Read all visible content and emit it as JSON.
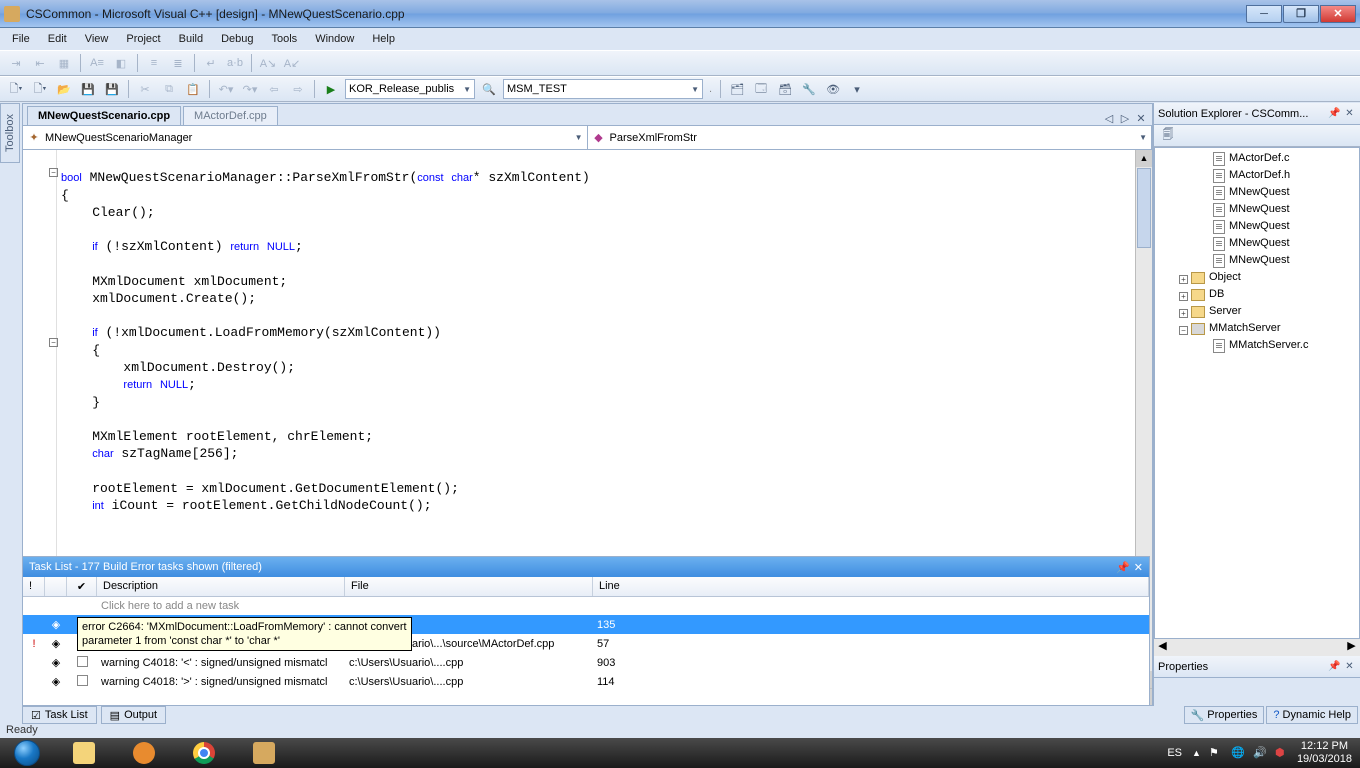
{
  "window": {
    "title": "CSCommon - Microsoft Visual C++ [design] - MNewQuestScenario.cpp"
  },
  "menu": [
    "File",
    "Edit",
    "View",
    "Project",
    "Build",
    "Debug",
    "Tools",
    "Window",
    "Help"
  ],
  "toolbar2": {
    "config": "KOR_Release_publis",
    "target": "MSM_TEST"
  },
  "tabs": {
    "active": "MNewQuestScenario.cpp",
    "inactive": "MActorDef.cpp"
  },
  "nav": {
    "cls": "MNewQuestScenarioManager",
    "member": "ParseXmlFromStr"
  },
  "code_lines": [
    "",
    "bool MNewQuestScenarioManager::ParseXmlFromStr(const char* szXmlContent)",
    "{",
    "    Clear();",
    "",
    "    if (!szXmlContent) return NULL;",
    "",
    "    MXmlDocument xmlDocument;",
    "    xmlDocument.Create();",
    "",
    "    if (!xmlDocument.LoadFromMemory(szXmlContent))",
    "    {",
    "        xmlDocument.Destroy();",
    "        return NULL;",
    "    }",
    "",
    "    MXmlElement rootElement, chrElement;",
    "    char szTagName[256];",
    "",
    "    rootElement = xmlDocument.GetDocumentElement();",
    "    int iCount = rootElement.GetChildNodeCount();"
  ],
  "solution": {
    "title": "Solution Explorer - CSComm...",
    "files": [
      "MActorDef.c",
      "MActorDef.h",
      "MNewQuest",
      "MNewQuest",
      "MNewQuest",
      "MNewQuest",
      "MNewQuest"
    ],
    "folders": [
      "Object",
      "DB",
      "Server"
    ],
    "project": "MMatchServer",
    "projfile": "MMatchServer.c"
  },
  "properties_title": "Properties",
  "tasklist": {
    "title": "Task List - 177 Build Error tasks shown (filtered)",
    "cols": [
      "!",
      "",
      "",
      "Description",
      "File",
      "Line"
    ],
    "newtask": "Click here to add a new task",
    "rows": [
      {
        "sel": true,
        "desc": "error C2664: 'MXmlDocument::LoadFromMemory' : cannot convert",
        "file": "pp",
        "line": "135"
      },
      {
        "desc": "error C2664: 'MXmlDocument::LoadFromMemory' : cannot convert",
        "file": "c:\\Users\\Usuario\\...\\source\\MActorDef.cpp",
        "line": "57",
        "err": true
      },
      {
        "desc": "warning C4018: '<' : signed/unsigned mismatcl",
        "file": "c:\\Users\\Usuario\\....cpp",
        "line": "903"
      },
      {
        "desc": "warning C4018: '>' : signed/unsigned mismatcl",
        "file": "c:\\Users\\Usuario\\....cpp",
        "line": "114"
      }
    ],
    "tooltip": "error C2664: 'MXmlDocument::LoadFromMemory' : cannot convert\nparameter 1 from 'const char *' to 'char *'"
  },
  "bottom_tabs": {
    "tasklist": "Task List",
    "output": "Output",
    "props": "Properties",
    "dynhelp": "Dynamic Help"
  },
  "status": "Ready",
  "toolbox": "Toolbox",
  "tray": {
    "lang": "ES",
    "time": "12:12 PM",
    "date": "19/03/2018"
  }
}
